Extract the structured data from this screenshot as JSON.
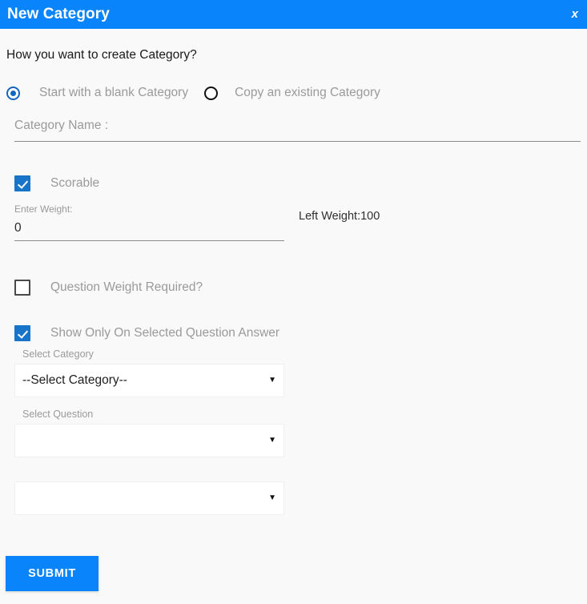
{
  "dialog": {
    "title": "New Category",
    "close_label": "x",
    "prompt": "How you want to create Category?"
  },
  "create_mode": {
    "options": [
      {
        "label": "Start with a blank Category",
        "selected": true
      },
      {
        "label": "Copy an existing Category",
        "selected": false
      }
    ]
  },
  "category_name": {
    "placeholder": "Category Name :",
    "value": ""
  },
  "scorable": {
    "label": "Scorable",
    "checked": true,
    "weight_caption": "Enter Weight:",
    "weight_value": "0",
    "left_weight": "Left Weight:100"
  },
  "question_weight": {
    "label": "Question Weight Required?",
    "checked": false
  },
  "show_only": {
    "label": "Show Only On Selected Question Answer",
    "checked": true
  },
  "selects": {
    "category": {
      "caption": "Select Category",
      "value": "--Select Category--",
      "arrow": "▼"
    },
    "question": {
      "caption": "Select Question",
      "value": "",
      "arrow": "▼"
    },
    "answer": {
      "caption": "",
      "value": "",
      "arrow": "▼"
    }
  },
  "actions": {
    "submit_label": "SUBMIT"
  },
  "colors": {
    "header_blue": "#0a84fa",
    "control_blue": "#1874c8",
    "radio_blue": "#1565c0",
    "muted_text": "#9a9a9a",
    "page_bg": "#f9f9f9"
  }
}
